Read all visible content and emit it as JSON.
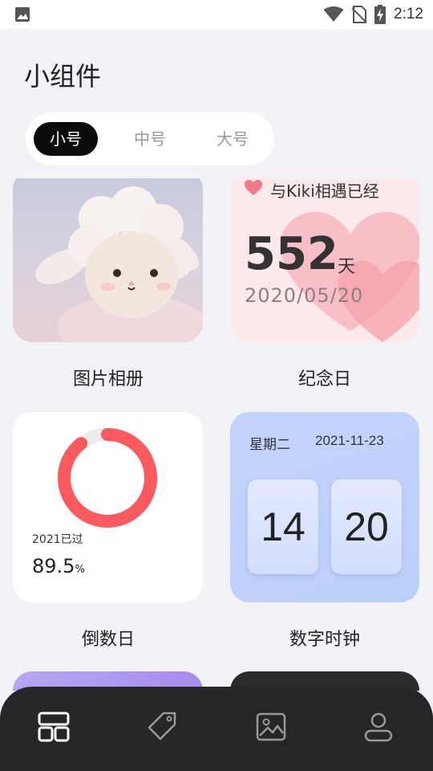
{
  "status_bar": {
    "time": "2:12",
    "icons": [
      "image-icon",
      "wifi-icon",
      "no-sim-icon",
      "battery-charging-icon"
    ]
  },
  "page_title": "小组件",
  "size_tabs": [
    {
      "label": "小号",
      "active": true
    },
    {
      "label": "中号",
      "active": false
    },
    {
      "label": "大号",
      "active": false
    }
  ],
  "widgets": {
    "photo": {
      "label": "图片相册"
    },
    "anniversary": {
      "label": "纪念日",
      "title": "与Kiki相遇已经",
      "days": "552",
      "unit": "天",
      "date": "2020/05/20"
    },
    "countdown": {
      "label": "倒数日",
      "caption": "2021已过",
      "percent": "89.5",
      "percent_sign": "%",
      "progress": 0.895
    },
    "clock": {
      "label": "数字时钟",
      "weekday": "星期二",
      "date": "2021-11-23",
      "hour": "14",
      "minute": "20"
    }
  },
  "colors": {
    "ring": "#fb5b5f",
    "ring_track": "#ececec",
    "nav_bg": "#262628",
    "active_tab": "#0b0b0b"
  },
  "bottom_nav": [
    "widgets-icon",
    "tag-icon",
    "gallery-icon",
    "profile-icon"
  ]
}
